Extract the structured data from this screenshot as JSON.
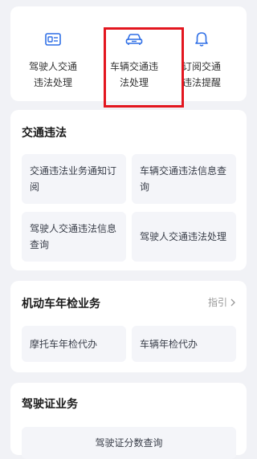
{
  "quick_actions": [
    {
      "label": "驾驶人交通\n违法处理",
      "icon": "id-card-icon"
    },
    {
      "label": "车辆交通违\n法处理",
      "icon": "car-icon"
    },
    {
      "label": "订阅交通\n违法提醒",
      "icon": "bell-icon"
    }
  ],
  "sections": {
    "traffic_violation": {
      "title": "交通违法",
      "items": [
        "交通违法业务通知订阅",
        "车辆交通违法信息查询",
        "驾驶人交通违法信息查询",
        "驾驶人交通违法处理"
      ]
    },
    "annual_inspection": {
      "title": "机动车年检业务",
      "guide": "指引",
      "items": [
        "摩托车年检代办",
        "车辆年检代办"
      ]
    },
    "license": {
      "title": "驾驶证业务",
      "items": [
        "驾驶证分数查询"
      ]
    }
  },
  "colors": {
    "accent": "#2f6fe6",
    "highlight": "#e3161f"
  }
}
